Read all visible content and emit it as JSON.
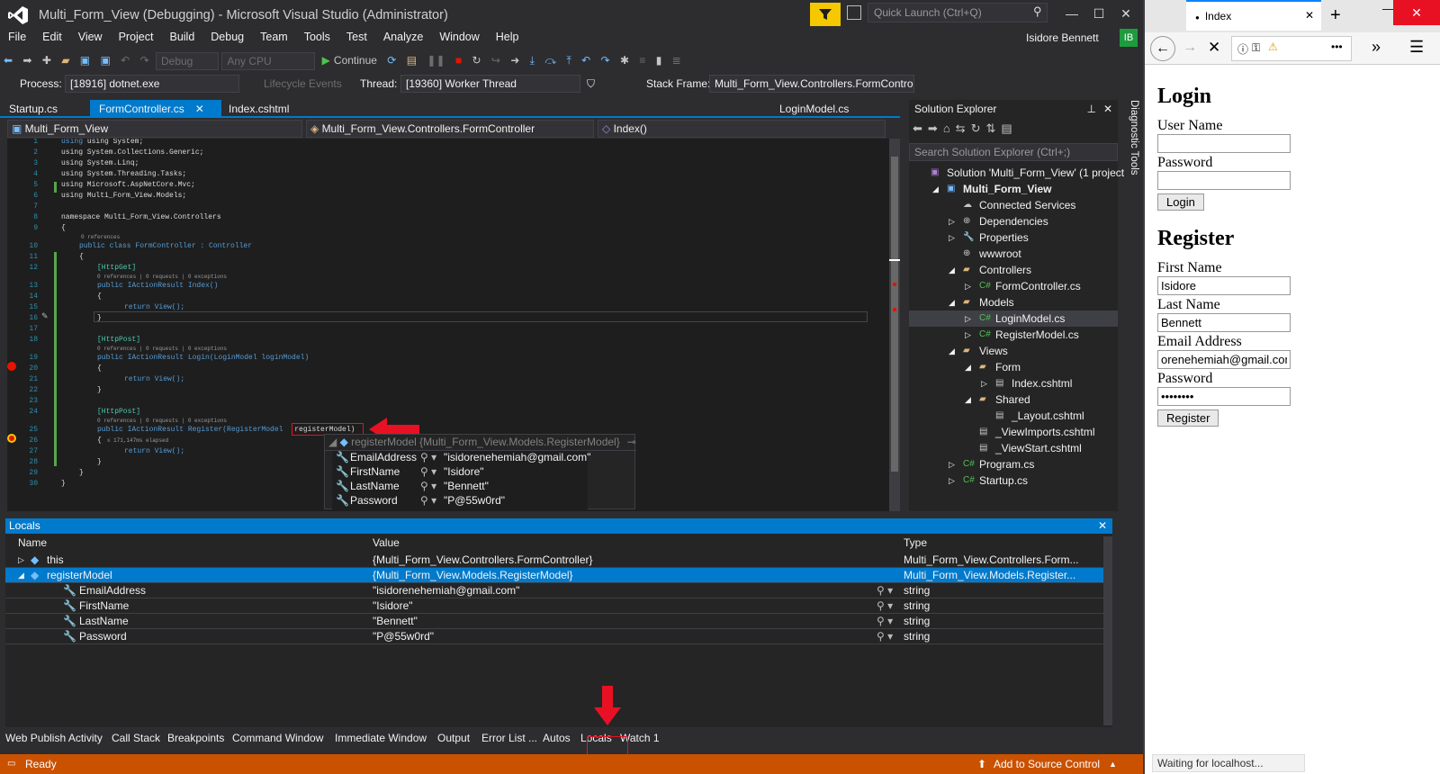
{
  "window": {
    "title": "Multi_Form_View (Debugging) - Microsoft Visual Studio  (Administrator)",
    "quick_launch_placeholder": "Quick Launch (Ctrl+Q)",
    "user_name": "Isidore Bennett",
    "user_initials": "IB",
    "minimize": "—",
    "maximize": "☐",
    "close": "✕"
  },
  "menu": [
    "File",
    "Edit",
    "View",
    "Project",
    "Build",
    "Debug",
    "Team",
    "Tools",
    "Test",
    "Analyze",
    "Window",
    "Help"
  ],
  "toolbar": {
    "config": "Debug",
    "platform": "Any CPU",
    "continue_label": "Continue"
  },
  "debug_location": {
    "process_label": "Process:",
    "process_value": "[18916] dotnet.exe",
    "lifecycle_label": "Lifecycle Events",
    "thread_label": "Thread:",
    "thread_value": "[19360] Worker Thread",
    "stackframe_label": "Stack Frame:",
    "stackframe_value": "Multi_Form_View.Controllers.FormContro"
  },
  "doc_tabs": {
    "startup": "Startup.cs",
    "formcontroller": "FormController.cs",
    "index": "Index.cshtml",
    "loginmodel": "LoginModel.cs"
  },
  "nav": {
    "project": "Multi_Form_View",
    "class": "Multi_Form_View.Controllers.FormController",
    "member": "Index()"
  },
  "code": {
    "line_numbers": [
      "1",
      "2",
      "3",
      "4",
      "5",
      "6",
      "7",
      "8",
      "9",
      "10",
      "11",
      "12",
      "13",
      "14",
      "15",
      "16",
      "17",
      "18",
      "19",
      "20",
      "21",
      "22",
      "23",
      "24",
      "25",
      "26",
      "27",
      "28",
      "29",
      "30"
    ],
    "l1": "using System;",
    "l2": "using System.Collections.Generic;",
    "l3": "using System.Linq;",
    "l4": "using System.Threading.Tasks;",
    "l5": "using Microsoft.AspNetCore.Mvc;",
    "l6": "using Multi_Form_View.Models;",
    "l8": "namespace Multi_Form_View.Controllers",
    "l9": "{",
    "lens_class": "0 references",
    "l10": "public class FormController : Controller",
    "l11": "{",
    "l12": "[HttpGet]",
    "lens_index": "0 references | 0 requests | 0 exceptions",
    "l13": "public IActionResult Index()",
    "l14": "{",
    "l15": "return View();",
    "l16": "}",
    "l18": "[HttpPost]",
    "lens_login": "0 references | 0 requests | 0 exceptions",
    "l19": "public IActionResult Login(LoginModel loginModel)",
    "l20": "{",
    "l21": "return View();",
    "l22": "}",
    "l24": "[HttpPost]",
    "lens_register": "0 references | 0 requests | 0 exceptions",
    "l25a": "public IActionResult Register(RegisterModel ",
    "l25b": "registerModel)",
    "l26": "{",
    "l26elapsed": "≤ 171,147ms elapsed",
    "l27": "return View();",
    "l28": "}",
    "l29": "}",
    "l30": "}"
  },
  "datatip": {
    "header_name": "registerModel",
    "header_value": "{Multi_Form_View.Models.RegisterModel}",
    "rows": [
      {
        "name": "EmailAddress",
        "value": "\"isidorenehemiah@gmail.com\""
      },
      {
        "name": "FirstName",
        "value": "\"Isidore\""
      },
      {
        "name": "LastName",
        "value": "\"Bennett\""
      },
      {
        "name": "Password",
        "value": "\"P@55w0rd\""
      }
    ]
  },
  "solution_explorer": {
    "title": "Solution Explorer",
    "search_placeholder": "Search Solution Explorer (Ctrl+;)",
    "items": [
      {
        "label": "Solution 'Multi_Form_View' (1 project",
        "indent": 0,
        "icon": "solution-icon",
        "expander": ""
      },
      {
        "label": "Multi_Form_View",
        "indent": 1,
        "icon": "project-icon",
        "expander": "◢",
        "bold": true
      },
      {
        "label": "Connected Services",
        "indent": 2,
        "icon": "cloud-icon",
        "expander": ""
      },
      {
        "label": "Dependencies",
        "indent": 2,
        "icon": "dependencies-icon",
        "expander": "▷"
      },
      {
        "label": "Properties",
        "indent": 2,
        "icon": "wrench-icon",
        "expander": "▷"
      },
      {
        "label": "wwwroot",
        "indent": 2,
        "icon": "globe-icon",
        "expander": ""
      },
      {
        "label": "Controllers",
        "indent": 2,
        "icon": "folder-icon",
        "expander": "◢"
      },
      {
        "label": "FormController.cs",
        "indent": 3,
        "icon": "csharp-file-icon",
        "expander": "▷"
      },
      {
        "label": "Models",
        "indent": 2,
        "icon": "folder-icon",
        "expander": "◢"
      },
      {
        "label": "LoginModel.cs",
        "indent": 3,
        "icon": "csharp-file-icon",
        "expander": "▷",
        "selected": true
      },
      {
        "label": "RegisterModel.cs",
        "indent": 3,
        "icon": "csharp-file-icon",
        "expander": "▷"
      },
      {
        "label": "Views",
        "indent": 2,
        "icon": "folder-icon",
        "expander": "◢"
      },
      {
        "label": "Form",
        "indent": 3,
        "icon": "folder-icon",
        "expander": "◢"
      },
      {
        "label": "Index.cshtml",
        "indent": 4,
        "icon": "razor-file-icon",
        "expander": "▷"
      },
      {
        "label": "Shared",
        "indent": 3,
        "icon": "folder-icon",
        "expander": "◢"
      },
      {
        "label": "_Layout.cshtml",
        "indent": 4,
        "icon": "razor-file-icon",
        "expander": ""
      },
      {
        "label": "_ViewImports.cshtml",
        "indent": 3,
        "icon": "razor-file-icon",
        "expander": ""
      },
      {
        "label": "_ViewStart.cshtml",
        "indent": 3,
        "icon": "razor-file-icon",
        "expander": ""
      },
      {
        "label": "Program.cs",
        "indent": 2,
        "icon": "csharp-file-icon",
        "expander": "▷"
      },
      {
        "label": "Startup.cs",
        "indent": 2,
        "icon": "csharp-file-icon",
        "expander": "▷"
      }
    ]
  },
  "diagnostic_tools": "Diagnostic Tools",
  "locals": {
    "title": "Locals",
    "col_name": "Name",
    "col_value": "Value",
    "col_type": "Type",
    "rows": [
      {
        "name": "this",
        "value": "{Multi_Form_View.Controllers.FormController}",
        "type": "Multi_Form_View.Controllers.Form...",
        "level": 0,
        "expander": "▷"
      },
      {
        "name": "registerModel",
        "value": "{Multi_Form_View.Models.RegisterModel}",
        "type": "Multi_Form_View.Models.Register...",
        "level": 0,
        "expander": "◢",
        "selected": true
      },
      {
        "name": "EmailAddress",
        "value": "\"isidorenehemiah@gmail.com\"",
        "type": "string",
        "level": 1,
        "expander": ""
      },
      {
        "name": "FirstName",
        "value": "\"Isidore\"",
        "type": "string",
        "level": 1,
        "expander": ""
      },
      {
        "name": "LastName",
        "value": "\"Bennett\"",
        "type": "string",
        "level": 1,
        "expander": ""
      },
      {
        "name": "Password",
        "value": "\"P@55w0rd\"",
        "type": "string",
        "level": 1,
        "expander": ""
      }
    ]
  },
  "bottom_tabs": [
    "Web Publish Activity",
    "Call Stack",
    "Breakpoints",
    "Command Window",
    "Immediate Window",
    "Output",
    "Error List ...",
    "Autos",
    "Locals",
    "Watch 1"
  ],
  "status": {
    "ready": "Ready",
    "source_control": "Add to Source Control"
  },
  "browser": {
    "tab_title": "Index",
    "status": "Waiting for localhost...",
    "login_heading": "Login",
    "user_name_label": "User Name",
    "password_label": "Password",
    "login_button": "Login",
    "register_heading": "Register",
    "first_name_label": "First Name",
    "first_name_value": "Isidore",
    "last_name_label": "Last Name",
    "last_name_value": "Bennett",
    "email_label": "Email Address",
    "email_value": "orenehemiah@gmail.com",
    "reg_password_label": "Password",
    "reg_password_value": "••••••••",
    "register_button": "Register"
  },
  "colors": {
    "accent": "#007acc",
    "status_bar": "#ca5100",
    "highlight_red": "#e81123"
  }
}
